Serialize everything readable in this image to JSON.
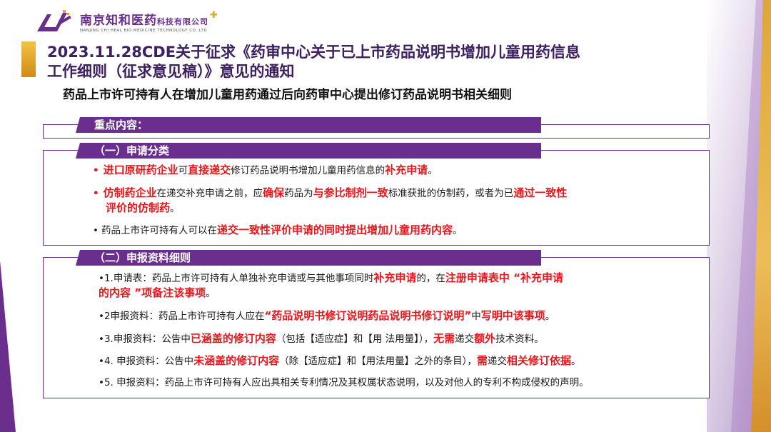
{
  "logo": {
    "name_main": "南京知和医药",
    "name_suffix": "科技有限公司",
    "name_en": "NANJING CHI HEAL BIO MEDICINE TECHNOLOGY CO.,LTD"
  },
  "title": {
    "line1": "2023.11.28CDE关于征求《药审中心关于已上市药品说明书增加儿童用药信息",
    "line2": "工作细则（征求意见稿）》意见的通知"
  },
  "subtitle": "药品上市许可持有人在增加儿童用药通过后向药审中心提出修订药品说明书相关细则",
  "section0": {
    "label": "重点内容："
  },
  "section1": {
    "label": "（一）申请分类",
    "items": [
      {
        "bullet": "•",
        "p1": "进口原研药企业",
        "p2": "可",
        "p3": "直接递交",
        "p4": "修订药品说明书增加儿童用药信息的",
        "p5": "补充申请",
        "p6": "。"
      },
      {
        "bullet": "•",
        "p1": "仿制药企业",
        "p2": "在递交补充申请之前，应",
        "p3": "确保",
        "p4": "药品为",
        "p5": "与参比制剂一致",
        "p6": "标准获批的仿制药，或者为已",
        "p7": "通过一致性",
        "p8": "评价的仿制药",
        "p9": "。"
      },
      {
        "bullet": "•",
        "p1": "药品上市许可持有人可以在",
        "p2": "递交一致性评价申请的同时提出增加儿童用药内容",
        "p3": "。"
      }
    ]
  },
  "section2": {
    "label": "（二）申报资料细则",
    "items": [
      {
        "a": "•1.申请表：药品上市许可持有人单独补充申请或与其他事项同时",
        "b": "补充申请",
        "c": "的，在",
        "d": "注册申请表中 “补充申请",
        "e": "的内容 ”项备注该事项",
        "f": "。"
      },
      {
        "a": "•2申报资料：药品上市许可持有人应在",
        "b": "“药品说明书修订说明药品说明书修订说明”",
        "c": "中",
        "d": "写明中该事项",
        "e": "。"
      },
      {
        "a": "•3.申报资料：公告中",
        "b": "已涵盖的修订内容",
        "c": "（包括【适应症】和【用 法用量】），",
        "d": "无需",
        "e": "递交",
        "f": "额外",
        "g": "技术资料。"
      },
      {
        "a": "•4. 申报资料：公告中",
        "b": "未涵盖的修订内容",
        "c": "（除【适应症】和【用法用量】之外的条目），",
        "d": "需",
        "e": "递交",
        "f": "相关修订依据",
        "g": "。"
      },
      {
        "a": "•5. 申报资料：药品上市许可持有人应出具相关专利情况及其权属状态说明，以及对他人的专利不构成侵权的声明。"
      }
    ]
  },
  "colors": {
    "purple": "#6a2e8c",
    "red": "#e8161d",
    "gold": "#e0a52a"
  }
}
